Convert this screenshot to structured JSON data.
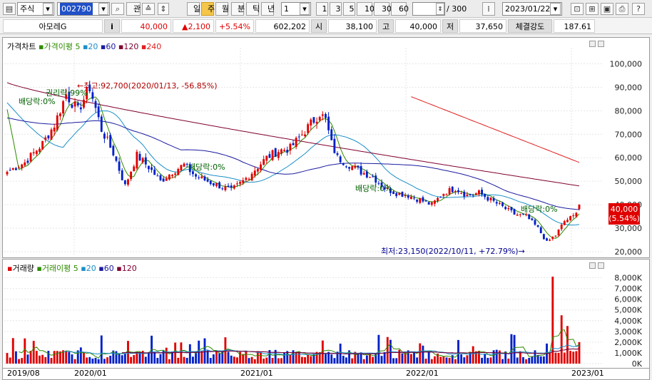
{
  "toolbar": {
    "market": "주식",
    "code": "002790",
    "tools": [
      "관"
    ],
    "periods": [
      "일",
      "주",
      "월",
      "분",
      "틱",
      "년"
    ],
    "period_selected": "주",
    "interval_value": "1",
    "quick_intervals": [
      "1",
      "3",
      "5",
      "10",
      "30",
      "60"
    ],
    "count": "180",
    "total": "/ 300",
    "date": "2023/01/22"
  },
  "info": {
    "name": "아모레G",
    "info_btn": "i",
    "price": "40,000",
    "change": "▲2,100",
    "change_pct": "+5.54%",
    "volume": "602,202",
    "open_label": "시",
    "open": "38,100",
    "high_label": "고",
    "high": "40,000",
    "low_label": "저",
    "low": "37,650",
    "strength_label": "체결강도",
    "strength": "187.61"
  },
  "price_panel": {
    "legend": {
      "title": "가격차트",
      "ma_title": "가격이평",
      "ma": [
        "5",
        "20",
        "60",
        "120",
        "240"
      ],
      "ma_colors": [
        "#2e8b00",
        "#1a8fc8",
        "#1a1aa0",
        "#800030",
        "#e02020"
      ]
    },
    "y_ticks": [
      "100,000",
      "90,000",
      "80,000",
      "70,000",
      "60,000",
      "50,000",
      "40,000",
      "30,000",
      "20,000"
    ],
    "current_price_label": "40,000",
    "current_pct_label": "(5.54%)",
    "annotations": {
      "max": "←최고:92,700(2020/01/13, -56.85%)",
      "min": "최저:23,150(2022/10/11, +72.79%)→",
      "rights": "권리락:99%",
      "div1": "배당락:0%",
      "div2": "배당락:0%",
      "div3": "배당락:0%",
      "div4": "배당락:0%"
    }
  },
  "volume_panel": {
    "legend": {
      "title": "거래량",
      "ma_title": "거래이평",
      "ma": [
        "5",
        "20",
        "60",
        "120"
      ],
      "ma_colors": [
        "#2e8b00",
        "#1a8fc8",
        "#1a1aa0",
        "#800030"
      ]
    },
    "y_ticks": [
      "8,000K",
      "7,000K",
      "6,000K",
      "5,000K",
      "4,000K",
      "3,000K",
      "2,000K",
      "1,000K",
      "0K"
    ]
  },
  "x_axis": [
    "2019/08",
    "2020/01",
    "2021/01",
    "2022/01",
    "2023/01"
  ],
  "chart_data": {
    "type": "candlestick",
    "x_labels": [
      "2019/08",
      "2020/01",
      "2021/01",
      "2022/01",
      "2023/01"
    ],
    "ylim": [
      20000,
      105000
    ],
    "first_week": "2019/08",
    "last_week": "2023/01",
    "anchors_close": [
      [
        0,
        54000
      ],
      [
        6,
        58000
      ],
      [
        12,
        66000
      ],
      [
        16,
        74000
      ],
      [
        20,
        87000
      ],
      [
        24,
        80000
      ],
      [
        28,
        90000
      ],
      [
        32,
        72000
      ],
      [
        36,
        62000
      ],
      [
        40,
        48000
      ],
      [
        44,
        61000
      ],
      [
        48,
        56000
      ],
      [
        52,
        50000
      ],
      [
        56,
        54000
      ],
      [
        60,
        57000
      ],
      [
        64,
        52000
      ],
      [
        68,
        50000
      ],
      [
        72,
        48000
      ],
      [
        76,
        46000
      ],
      [
        80,
        50000
      ],
      [
        84,
        55000
      ],
      [
        88,
        60000
      ],
      [
        92,
        63000
      ],
      [
        96,
        64000
      ],
      [
        100,
        70000
      ],
      [
        104,
        76000
      ],
      [
        106,
        79000
      ],
      [
        108,
        76000
      ],
      [
        110,
        66000
      ],
      [
        112,
        60000
      ],
      [
        116,
        57000
      ],
      [
        120,
        54000
      ],
      [
        124,
        52000
      ],
      [
        128,
        47000
      ],
      [
        132,
        45000
      ],
      [
        136,
        44000
      ],
      [
        140,
        42000
      ],
      [
        144,
        40000
      ],
      [
        148,
        45000
      ],
      [
        152,
        47000
      ],
      [
        156,
        44000
      ],
      [
        160,
        45000
      ],
      [
        164,
        42000
      ],
      [
        168,
        39000
      ],
      [
        172,
        36000
      ],
      [
        176,
        35000
      ],
      [
        180,
        30000
      ],
      [
        183,
        24000
      ],
      [
        186,
        27000
      ],
      [
        189,
        33000
      ],
      [
        192,
        35000
      ],
      [
        194,
        40000
      ]
    ],
    "highlights": {
      "max": 92700,
      "max_date": "2020/01/13",
      "min": 23150,
      "min_date": "2022/10/11"
    },
    "last_candle": {
      "open": 38100,
      "high": 40000,
      "low": 37650,
      "close": 40000
    },
    "volume_ylim": [
      0,
      8500
    ],
    "volume_unit": "K",
    "volume_spikes": [
      [
        185,
        8100
      ],
      [
        188,
        4500
      ],
      [
        190,
        3500
      ],
      [
        194,
        2000
      ]
    ]
  }
}
